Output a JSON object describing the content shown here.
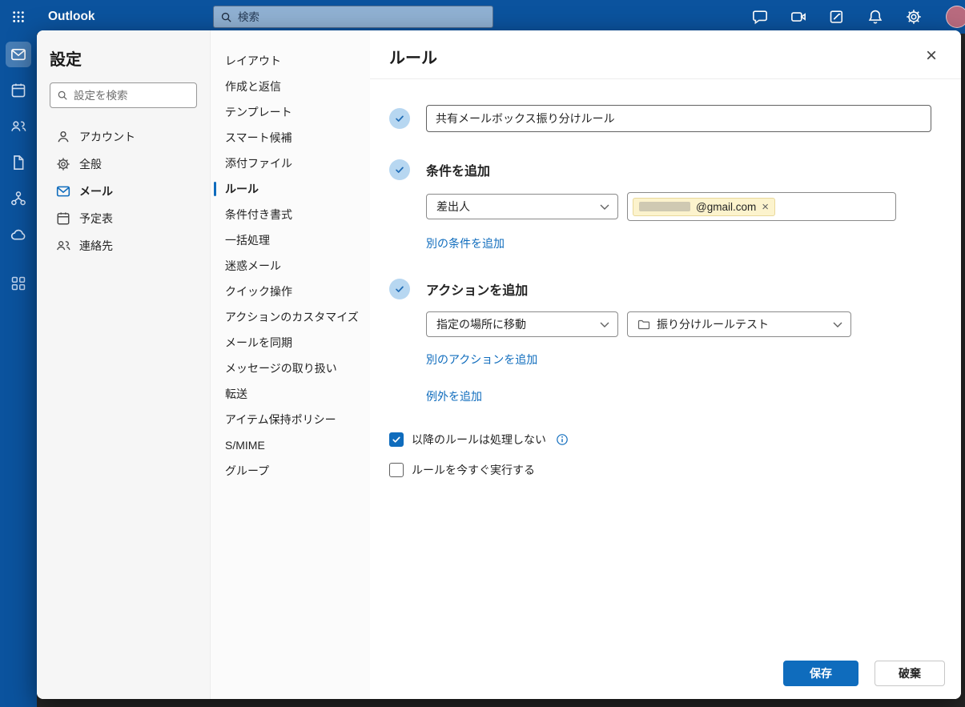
{
  "topbar": {
    "app_name": "Outlook",
    "search_placeholder": "検索",
    "icons": [
      "chat-icon",
      "meet-icon",
      "notes-icon",
      "bell-icon",
      "gear-icon",
      "avatar"
    ]
  },
  "rail": {
    "items": [
      "mail",
      "calendar",
      "people",
      "files",
      "groups",
      "cloud",
      "apps"
    ],
    "selected": "mail"
  },
  "settings": {
    "title": "設定",
    "search_placeholder": "設定を検索",
    "nav": [
      {
        "label": "アカウント",
        "icon": "person-icon",
        "selected": false
      },
      {
        "label": "全般",
        "icon": "gear-icon",
        "selected": false
      },
      {
        "label": "メール",
        "icon": "mail-icon",
        "selected": true
      },
      {
        "label": "予定表",
        "icon": "calendar-icon",
        "selected": false
      },
      {
        "label": "連絡先",
        "icon": "people-icon",
        "selected": false
      }
    ],
    "categories": [
      {
        "label": "レイアウト"
      },
      {
        "label": "作成と返信"
      },
      {
        "label": "テンプレート"
      },
      {
        "label": "スマート候補"
      },
      {
        "label": "添付ファイル"
      },
      {
        "label": "ルール",
        "selected": true
      },
      {
        "label": "条件付き書式"
      },
      {
        "label": "一括処理"
      },
      {
        "label": "迷惑メール"
      },
      {
        "label": "クイック操作"
      },
      {
        "label": "アクションのカスタマイズ"
      },
      {
        "label": "メールを同期"
      },
      {
        "label": "メッセージの取り扱い"
      },
      {
        "label": "転送"
      },
      {
        "label": "アイテム保持ポリシー"
      },
      {
        "label": "S/MIME"
      },
      {
        "label": "グループ"
      }
    ]
  },
  "panel": {
    "title": "ルール",
    "rule_name": "共有メールボックス振り分けルール",
    "conditions": {
      "heading": "条件を追加",
      "type_value": "差出人",
      "chip_text": "@gmail.com",
      "prefix_redacted": true,
      "add_link": "別の条件を追加"
    },
    "actions": {
      "heading": "アクションを追加",
      "type_value": "指定の場所に移動",
      "folder_value": "振り分けルールテスト",
      "add_link": "別のアクションを追加",
      "exception_link": "例外を追加"
    },
    "options": [
      {
        "label": "以降のルールは処理しない",
        "checked": true,
        "info": true
      },
      {
        "label": "ルールを今すぐ実行する",
        "checked": false
      }
    ],
    "save_label": "保存",
    "discard_label": "破棄"
  },
  "colors": {
    "accent": "#0f6cbd",
    "header": "#0b539e",
    "chip_bg": "#fcf3cd"
  }
}
